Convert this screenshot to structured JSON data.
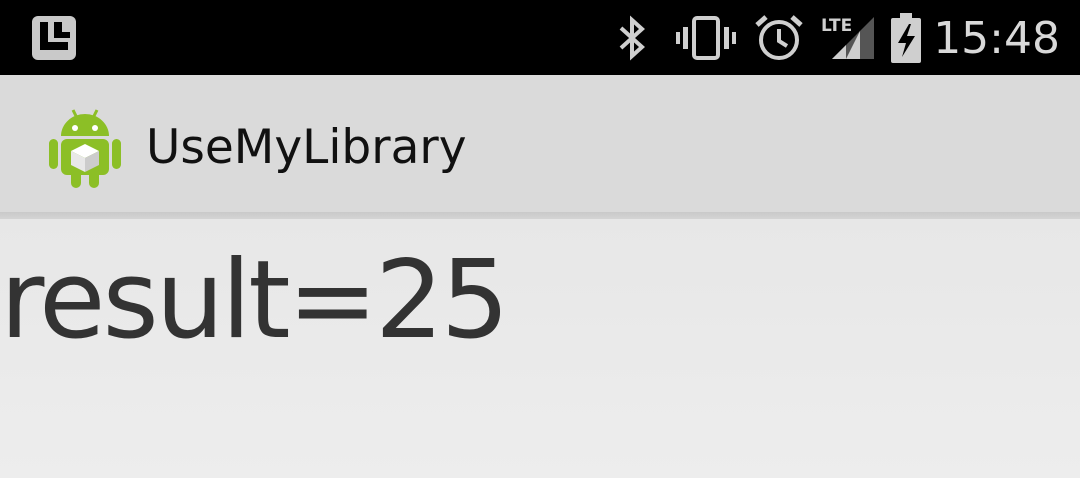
{
  "status_bar": {
    "time": "15:48",
    "network_label": "LTE",
    "icons": [
      "notification-app-icon",
      "bluetooth-icon",
      "vibrate-icon",
      "alarm-icon",
      "lte-signal-icon",
      "battery-charging-icon"
    ]
  },
  "action_bar": {
    "title": "UseMyLibrary",
    "app_icon": "android-robot-icon"
  },
  "main": {
    "result_text": "result=25"
  },
  "colors": {
    "status_bar_bg": "#000000",
    "status_icon": "#d0d0d0",
    "action_bar_bg": "#dadada",
    "content_bg": "#ececec",
    "android_green": "#8cbf26"
  }
}
